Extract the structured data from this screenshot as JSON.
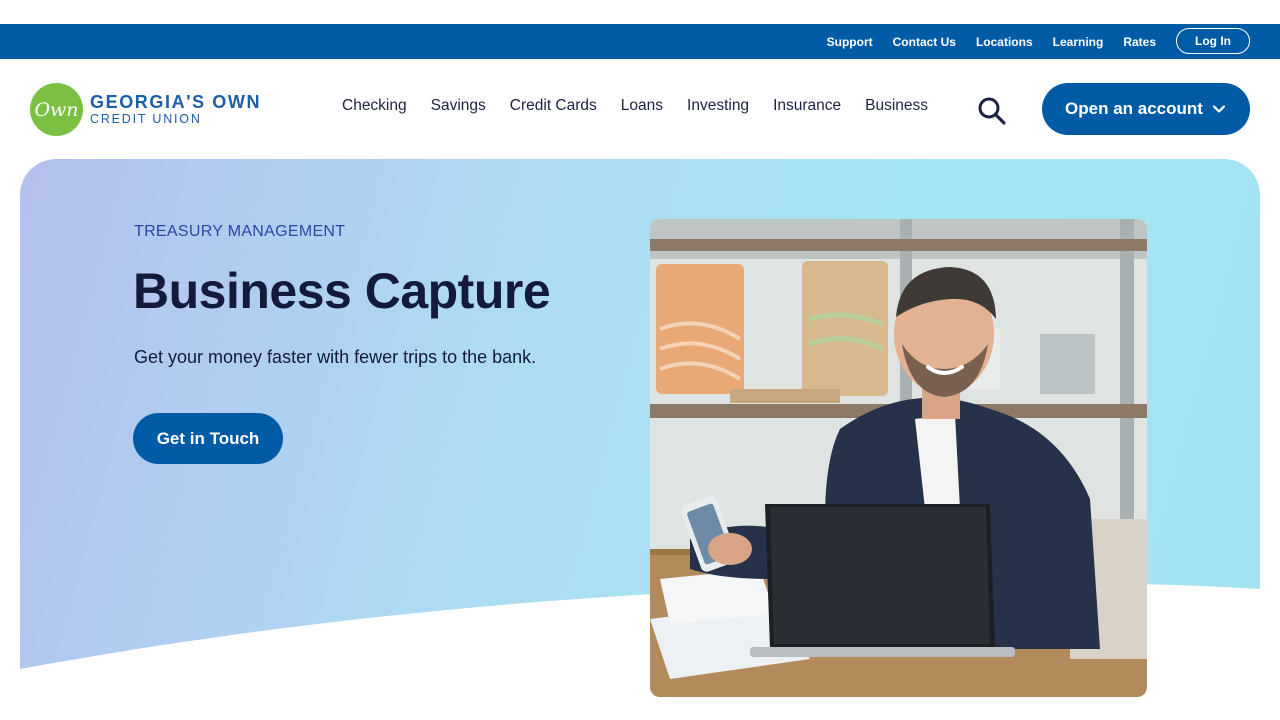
{
  "utility_nav": {
    "links": [
      "Support",
      "Contact Us",
      "Locations",
      "Learning",
      "Rates"
    ],
    "login_label": "Log In"
  },
  "brand": {
    "mark_text": "Own",
    "name": "GEORGIA'S OWN",
    "subtitle": "CREDIT UNION"
  },
  "main_nav": {
    "items": [
      "Checking",
      "Savings",
      "Credit Cards",
      "Loans",
      "Investing",
      "Insurance",
      "Business"
    ],
    "search_icon": "search-icon",
    "cta_label": "Open an account"
  },
  "hero": {
    "eyebrow": "TREASURY MANAGEMENT",
    "title": "Business Capture",
    "subtitle": "Get your money faster with fewer trips to the bank.",
    "button_label": "Get in Touch"
  },
  "colors": {
    "primary_blue": "#005ba6",
    "brand_green": "#7bc043",
    "heading_navy": "#141a3b",
    "eyebrow_blue": "#2a47a4"
  }
}
